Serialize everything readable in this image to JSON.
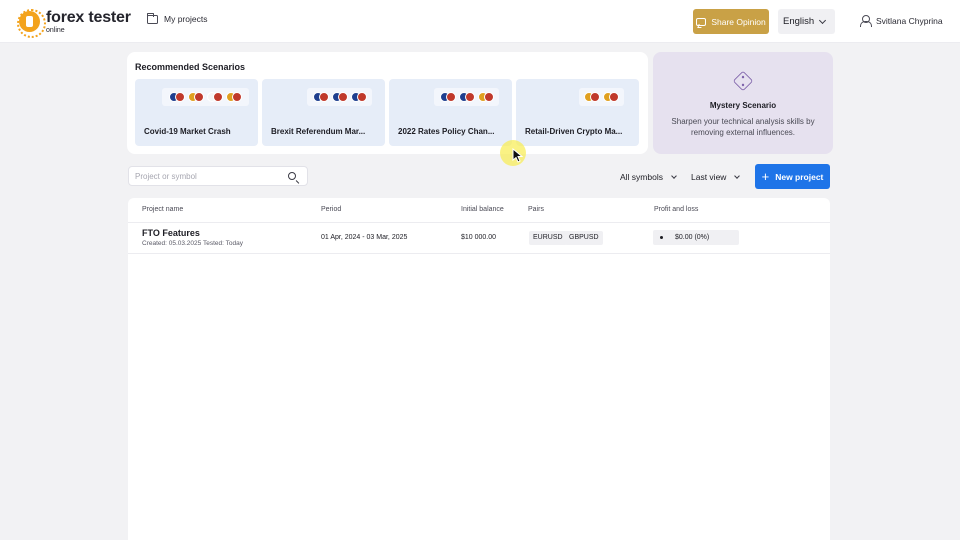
{
  "header": {
    "logo_title": "forex tester",
    "logo_sub": "online",
    "my_projects": "My projects",
    "share_opinion": "Share Opinion",
    "language": "English",
    "user_name": "Svitlana Chyprina"
  },
  "scenarios": {
    "title": "Recommended Scenarios",
    "cards": [
      {
        "name": "Covid-19 Market Crash",
        "flag_pairs": [
          [
            "#1f3f8f",
            "#c0392b"
          ],
          [
            "#e0a020",
            "#c0392b"
          ],
          [
            "#f5f5f5",
            "#c0392b"
          ],
          [
            "#e0a020",
            "#c0392b"
          ]
        ]
      },
      {
        "name": "Brexit Referendum Mar...",
        "flag_pairs": [
          [
            "#1f3f8f",
            "#c0392b"
          ],
          [
            "#1f3f8f",
            "#c0392b"
          ],
          [
            "#1f3f8f",
            "#c0392b"
          ]
        ]
      },
      {
        "name": "2022 Rates Policy Chan...",
        "flag_pairs": [
          [
            "#1f3f8f",
            "#c0392b"
          ],
          [
            "#1f3f8f",
            "#c0392b"
          ],
          [
            "#e0a020",
            "#c0392b"
          ]
        ]
      },
      {
        "name": "Retail-Driven Crypto Ma...",
        "flag_pairs": [
          [
            "#e0a020",
            "#c0392b"
          ],
          [
            "#e0a020",
            "#c0392b"
          ]
        ]
      }
    ],
    "mystery": {
      "title": "Mystery Scenario",
      "description": "Sharpen your technical analysis skills by removing external influences."
    }
  },
  "toolbar": {
    "search_placeholder": "Project or symbol",
    "symbols_filter": "All symbols",
    "sort_filter": "Last view",
    "new_project": "New project"
  },
  "table": {
    "headers": [
      "Project name",
      "Period",
      "Initial balance",
      "Pairs",
      "Profit and loss"
    ],
    "rows": [
      {
        "name": "FTO Features",
        "meta": "Created: 05.03.2025 Tested: Today",
        "period": "01 Apr, 2024 - 03 Mar, 2025",
        "balance": "$10 000.00",
        "pairs": [
          "EURUSD",
          "GBPUSD"
        ],
        "pnl": "$0.00 (0%)"
      }
    ]
  },
  "colors": {
    "accent_blue": "#1e74e8",
    "share_gold": "#c9a146",
    "logo_orange": "#f3a31c",
    "scenario_card": "#e6edf8",
    "mystery_card": "#e6e1ef"
  }
}
